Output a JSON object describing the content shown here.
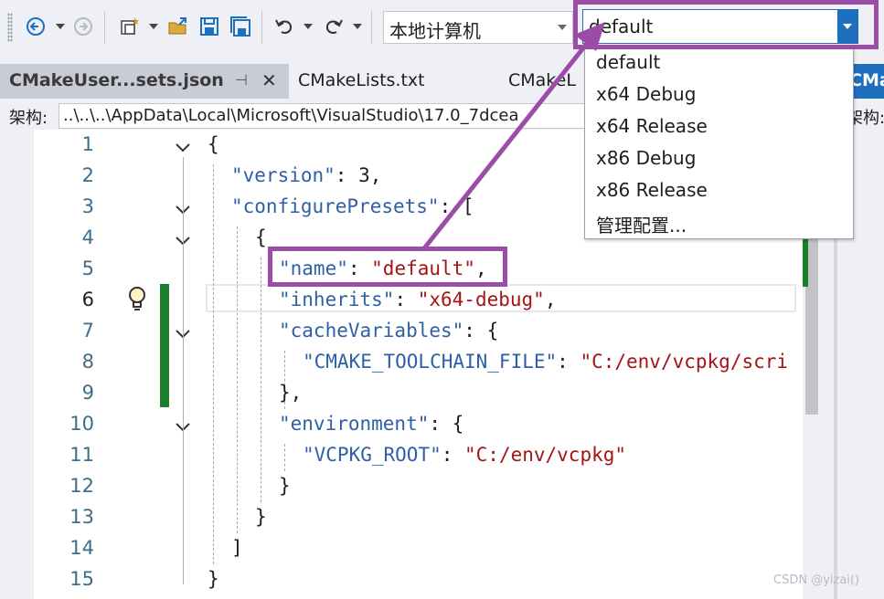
{
  "toolbar": {
    "platform_combo_value": "本地计算机",
    "config_combo_value": "default"
  },
  "tabs": [
    {
      "label": "CMakeUser...sets.json",
      "active": true
    },
    {
      "label": "CMakeLists.txt",
      "active": false
    },
    {
      "label": "CMakeL",
      "active": false
    },
    {
      "label": "CMa",
      "active": false
    }
  ],
  "pathbar": {
    "label": "架构:",
    "path": "..\\..\\..\\AppData\\Local\\Microsoft\\VisualStudio\\17.0_7dcea",
    "label_right": "架构:"
  },
  "editor": {
    "line_numbers": [
      "1",
      "2",
      "3",
      "4",
      "5",
      "6",
      "7",
      "8",
      "9",
      "10",
      "11",
      "12",
      "13",
      "14",
      "15"
    ],
    "current_line": "6",
    "lines": [
      [
        {
          "t": "p",
          "v": "{"
        }
      ],
      [
        {
          "t": "k",
          "v": "\"version\""
        },
        {
          "t": "p",
          "v": ": 3,"
        }
      ],
      [
        {
          "t": "k",
          "v": "\"configurePresets\""
        },
        {
          "t": "p",
          "v": ": ["
        }
      ],
      [
        {
          "t": "p",
          "v": "{"
        }
      ],
      [
        {
          "t": "k",
          "v": "\"name\""
        },
        {
          "t": "p",
          "v": ": "
        },
        {
          "t": "s",
          "v": "\"default\""
        },
        {
          "t": "p",
          "v": ","
        }
      ],
      [
        {
          "t": "k",
          "v": "\"inherits\""
        },
        {
          "t": "p",
          "v": ": "
        },
        {
          "t": "s",
          "v": "\"x64-debug\""
        },
        {
          "t": "p",
          "v": ","
        }
      ],
      [
        {
          "t": "k",
          "v": "\"cacheVariables\""
        },
        {
          "t": "p",
          "v": ": {"
        }
      ],
      [
        {
          "t": "k",
          "v": "\"CMAKE_TOOLCHAIN_FILE\""
        },
        {
          "t": "p",
          "v": ": "
        },
        {
          "t": "s",
          "v": "\"C:/env/vcpkg/scri"
        }
      ],
      [
        {
          "t": "p",
          "v": "},"
        }
      ],
      [
        {
          "t": "k",
          "v": "\"environment\""
        },
        {
          "t": "p",
          "v": ": {"
        }
      ],
      [
        {
          "t": "k",
          "v": "\"VCPKG_ROOT\""
        },
        {
          "t": "p",
          "v": ": "
        },
        {
          "t": "s",
          "v": "\"C:/env/vcpkg\""
        }
      ],
      [
        {
          "t": "p",
          "v": "}"
        }
      ],
      [
        {
          "t": "p",
          "v": "}"
        }
      ],
      [
        {
          "t": "p",
          "v": "]"
        }
      ],
      [
        {
          "t": "p",
          "v": "}"
        }
      ]
    ]
  },
  "dropdown": {
    "items": [
      "default",
      "x64 Debug",
      "x64 Release",
      "x86 Debug",
      "x86 Release",
      "管理配置..."
    ]
  },
  "watermark": "CSDN @yizai()",
  "colors": {
    "annotation": "#9b4ca6",
    "json_key": "#2f5fa6",
    "json_string": "#a31515",
    "change_bar": "#1b7e2a",
    "combo_button": "#1f6fbf"
  }
}
